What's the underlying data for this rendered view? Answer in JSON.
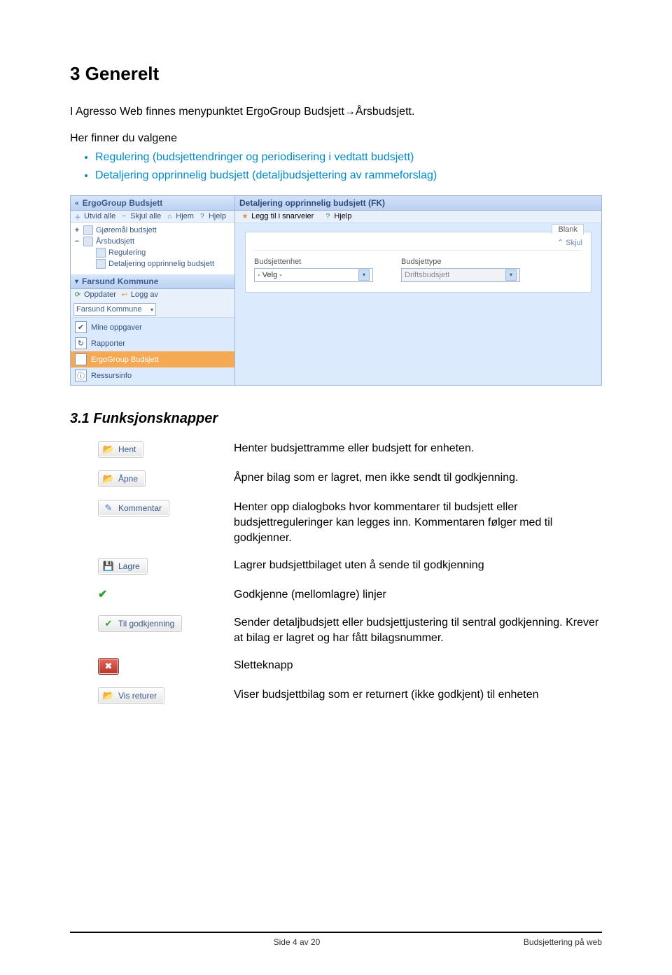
{
  "heading_3": "3  Generelt",
  "intro_sentence": "I Agresso Web finnes menypunktet ErgoGroup Budsjett→Årsbudsjett.",
  "lead_in": "Her finner du valgene",
  "bullets": [
    {
      "text": "Regulering (budsjettendringer og periodisering i vedtatt budsjett)",
      "blue": true
    },
    {
      "text": "Detaljering opprinnelig budsjett (detaljbudsjettering av rammeforslag)",
      "blue": true
    }
  ],
  "screenshot": {
    "left": {
      "panel": "ErgoGroup Budsjett",
      "toolbar": [
        "Utvid alle",
        "Skjul alle",
        "Hjem",
        "Hjelp"
      ],
      "tree": {
        "lvl1": "Gjøremål budsjett",
        "lvl2": "Årsbudsjett",
        "lvl3a": "Regulering",
        "lvl3b": "Detaljering opprinnelig budsjett"
      },
      "panel2": "Farsund Kommune",
      "toolbar2_oppdater": "Oppdater",
      "toolbar2_loggav": "Logg av",
      "toolbar2_select": "Farsund Kommune",
      "items": [
        "Mine oppgaver",
        "Rapporter",
        "ErgoGroup Budsjett",
        "Ressursinfo"
      ],
      "selected_index": 2
    },
    "right": {
      "title": "Detaljering opprinnelig budsjett (FK)",
      "toolbar_sn": "Legg til i snarveier",
      "toolbar_help": "Hjelp",
      "blank": "Blank",
      "skjul": "Skjul",
      "field1_label": "Budsjettenhet",
      "field1_value": "- Velg -",
      "field2_label": "Budsjettype",
      "field2_value": "Driftsbudsjett"
    }
  },
  "heading_31": "3.1 Funksjonsknapper",
  "fb": [
    {
      "kind": "btn",
      "label": "Hent",
      "desc": "Henter budsjettramme eller budsjett for enheten.",
      "ico_color": "#d9972d",
      "ico": "📂"
    },
    {
      "kind": "btn",
      "label": "Åpne",
      "desc": "Åpner bilag som er lagret, men ikke sendt til godkjenning.",
      "ico_color": "#d99a34",
      "ico": "📂"
    },
    {
      "kind": "btn",
      "label": "Kommentar",
      "desc": "Henter opp dialogboks hvor kommentarer til budsjett eller budsjettreguleringer kan legges inn. Kommentaren følger med til godkjenner.",
      "ico_color": "#4b79c9",
      "ico": "✎"
    },
    {
      "kind": "btn",
      "label": "Lagre",
      "desc": "Lagrer budsjettbilaget uten å sende til godkjenning",
      "ico_color": "#4b79c9",
      "ico": "💾"
    },
    {
      "kind": "tick",
      "desc": "Godkjenne (mellomlagre) linjer"
    },
    {
      "kind": "btn",
      "label": "Til godkjenning",
      "desc": "Sender detaljbudsjett eller budsjettjustering til sentral godkjenning. Krever at bilag er lagret og har fått bilagsnummer.",
      "ico_color": "#2b9f2b",
      "ico": "✔"
    },
    {
      "kind": "redx",
      "desc": "Sletteknapp",
      "ico": "✖"
    },
    {
      "kind": "btn",
      "label": "Vis returer",
      "desc": "Viser budsjettbilag som er returnert (ikke godkjent) til enheten",
      "ico_color": "#d99a34",
      "ico": "📂"
    }
  ],
  "footer_left": "Side 4 av 20",
  "footer_right": "Budsjettering på web"
}
